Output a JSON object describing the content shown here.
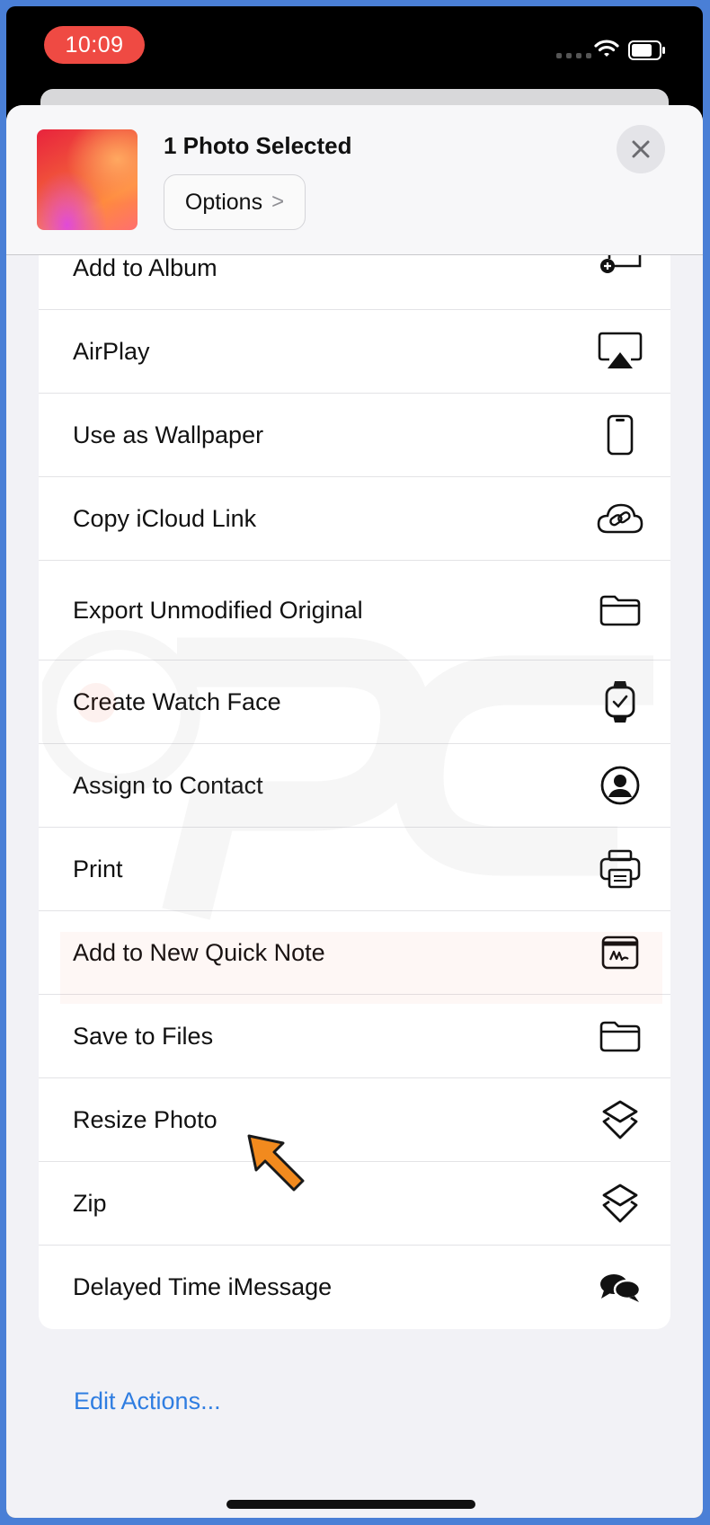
{
  "status_bar": {
    "time": "10:09"
  },
  "header": {
    "title": "1 Photo Selected",
    "options_label": "Options",
    "options_chevron": ">",
    "close_icon": "close-icon"
  },
  "actions": [
    {
      "label": "Add to Album",
      "icon": "add-to-album-icon"
    },
    {
      "label": "AirPlay",
      "icon": "airplay-icon"
    },
    {
      "label": "Use as Wallpaper",
      "icon": "phone-icon"
    },
    {
      "label": "Copy iCloud Link",
      "icon": "cloud-link-icon"
    },
    {
      "label": "Export Unmodified Original",
      "icon": "folder-icon"
    },
    {
      "label": "Create Watch Face",
      "icon": "watch-icon"
    },
    {
      "label": "Assign to Contact",
      "icon": "contact-icon"
    },
    {
      "label": "Print",
      "icon": "printer-icon"
    },
    {
      "label": "Add to New Quick Note",
      "icon": "quick-note-icon"
    },
    {
      "label": "Save to Files",
      "icon": "folder-icon"
    },
    {
      "label": "Resize Photo",
      "icon": "shortcuts-icon"
    },
    {
      "label": "Zip",
      "icon": "shortcuts-icon"
    },
    {
      "label": "Delayed Time iMessage",
      "icon": "messages-icon"
    }
  ],
  "footer": {
    "edit_actions": "Edit Actions..."
  },
  "colors": {
    "accent": "#2f7de1",
    "border": "#4a7fd6",
    "time_pill": "#ef4a43",
    "arrow": "#f28a1e"
  }
}
